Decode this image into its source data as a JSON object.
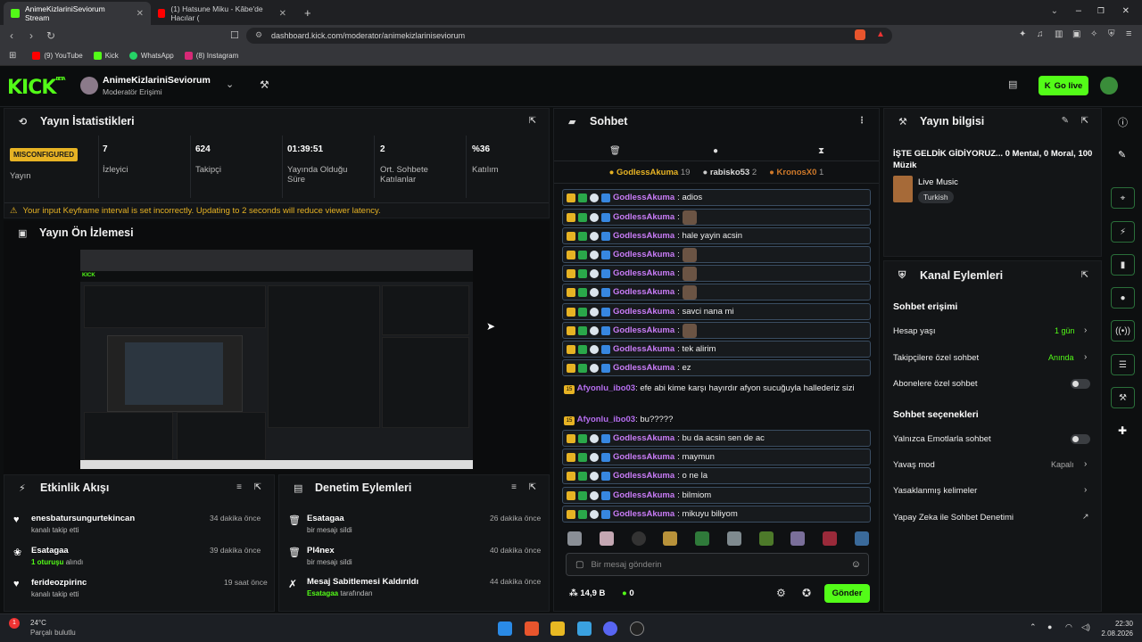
{
  "browser": {
    "tabs": [
      {
        "title": "AnimeKizlariniSeviorum Stream",
        "active": true
      },
      {
        "title": "(1) Hatsune Miku - Kâbe'de Hacılar (",
        "active": false
      }
    ],
    "new_tab": "+",
    "url": "dashboard.kick.com/moderator/animekizlariniseviorum",
    "bookmarks": [
      "(9) YouTube",
      "Kick",
      "WhatsApp",
      "(8) Instagram"
    ]
  },
  "header": {
    "logo": "KICK",
    "logo_beta": "BETA",
    "channel_name": "AnimeKizlariniSeviorum",
    "role": "Moderatör Erişimi",
    "go_live": "Go live"
  },
  "stats": {
    "title": "Yayın İstatistikleri",
    "status_badge": "MISCONFIGURED",
    "status_label": "Yayın",
    "items": [
      {
        "value": "7",
        "label": "İzleyici"
      },
      {
        "value": "624",
        "label": "Takipçi"
      },
      {
        "value": "01:39:51",
        "label": "Yayında Olduğu Süre"
      },
      {
        "value": "2",
        "label": "Ort. Sohbete Katılanlar"
      },
      {
        "value": "%36",
        "label": "Katılım"
      }
    ],
    "warning": "Your input Keyframe interval is set incorrectly. Updating to 2 seconds will reduce viewer latency."
  },
  "preview": {
    "title": "Yayın Ön İzlemesi"
  },
  "activity": {
    "title": "Etkinlik Akışı",
    "items": [
      {
        "name": "enesbatursungurtekincan",
        "action": "kanalı takip etti",
        "time": "34 dakika önce"
      },
      {
        "name": "Esatagaa",
        "action_highlight": "1 oturuşu",
        "action": "alındı",
        "time": "39 dakika önce"
      },
      {
        "name": "ferideozpirinc",
        "action": "kanalı takip etti",
        "time": "19 saat önce"
      }
    ]
  },
  "moderation": {
    "title": "Denetim Eylemleri",
    "items": [
      {
        "name": "Esatagaa",
        "action": "bir mesajı sildi",
        "time": "26 dakika önce"
      },
      {
        "name": "Pl4nex",
        "action": "bir mesajı sildi",
        "time": "40 dakika önce"
      },
      {
        "name": "Mesaj Sabitlemesi Kaldırıldı",
        "action_highlight": "Esatagaa",
        "action": "tarafından",
        "time": "44 dakika önce"
      }
    ]
  },
  "chat": {
    "title": "Sohbet",
    "top_users": [
      {
        "name": "GodlessAkuma",
        "count": "19"
      },
      {
        "name": "rabisko53",
        "count": "2"
      },
      {
        "name": "KronosX0",
        "count": "1"
      }
    ],
    "messages": [
      {
        "user": "GodlessAkuma",
        "text": ": adios",
        "emote": false
      },
      {
        "user": "GodlessAkuma",
        "text": ":",
        "emote": true
      },
      {
        "user": "GodlessAkuma",
        "text": ": hale yayin acsin",
        "emote": false
      },
      {
        "user": "GodlessAkuma",
        "text": ":",
        "emote": true
      },
      {
        "user": "GodlessAkuma",
        "text": ":",
        "emote": true
      },
      {
        "user": "GodlessAkuma",
        "text": ":",
        "emote": true
      },
      {
        "user": "GodlessAkuma",
        "text": ": savci nana mi",
        "emote": false
      },
      {
        "user": "GodlessAkuma",
        "text": ":",
        "emote": true
      },
      {
        "user": "GodlessAkuma",
        "text": ": tek alirim",
        "emote": false
      },
      {
        "user": "GodlessAkuma",
        "text": ": ez",
        "emote": false
      }
    ],
    "afyon_messages": [
      {
        "badge": "15",
        "user": "Afyonlu_ibo03",
        "text": ": efe abi kime karşı hayırdır afyon sucuğuyla hallederiz sizi"
      },
      {
        "badge": "15",
        "user": "Afyonlu_ibo03",
        "text": ": bu?????"
      }
    ],
    "messages2": [
      {
        "user": "GodlessAkuma",
        "text": ": bu da acsin sen de ac"
      },
      {
        "user": "GodlessAkuma",
        "text": ": maymun"
      },
      {
        "user": "GodlessAkuma",
        "text": ": o ne la"
      },
      {
        "user": "GodlessAkuma",
        "text": ": bilmiom"
      },
      {
        "user": "GodlessAkuma",
        "text": ": mikuyu biliyom"
      }
    ],
    "input_placeholder": "Bir mesaj gönderin",
    "points": "14,9 B",
    "kick_points": "0",
    "send": "Gönder"
  },
  "stream_info": {
    "title": "Yayın bilgisi",
    "stream_title": "İŞTE GELDİK GİDİYORUZ... 0 Mental, 0 Moral, 100 Müzik",
    "category": "Live Music",
    "tag": "Turkish"
  },
  "channel_actions": {
    "title": "Kanal Eylemleri",
    "chat_access_title": "Sohbet erişimi",
    "account_age": {
      "label": "Hesap yaşı",
      "value": "1 gün"
    },
    "followers_only": {
      "label": "Takipçilere özel sohbet",
      "value": "Anında"
    },
    "subs_only": {
      "label": "Abonelere özel sohbet"
    },
    "chat_options_title": "Sohbet seçenekleri",
    "emote_only": {
      "label": "Yalnızca Emotlarla sohbet"
    },
    "slow_mode": {
      "label": "Yavaş mod",
      "value": "Kapalı"
    },
    "banned_words": {
      "label": "Yasaklanmış kelimeler"
    },
    "ai_moderation": {
      "label": "Yapay Zeka ile Sohbet Denetimi"
    }
  },
  "taskbar": {
    "weather_temp": "24°C",
    "weather_desc": "Parçalı bulutlu",
    "time": "22:30",
    "date": "2.08.2026"
  },
  "colors": {
    "accent": "#53fc18",
    "username": "#c97cf7",
    "warning": "#e7b324",
    "badge_misconfigured": "#e7b324"
  }
}
